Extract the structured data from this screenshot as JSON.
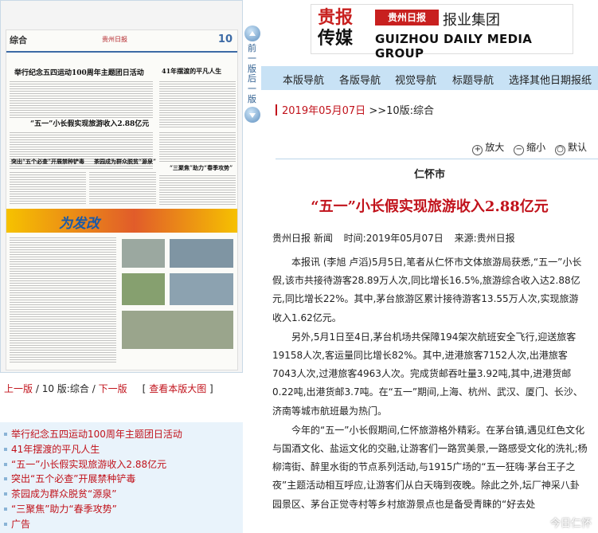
{
  "thumbnail": {
    "section": "综合",
    "masthead": "贵州日报",
    "page_number": "10",
    "headlines": [
      "举行纪念五四运动100周年主题团日活动",
      "41年摆渡的平凡人生",
      "“五一”小长假实现旅游收入2.88亿元",
      "突出“五个必查”开展禁种铲毒",
      "茶园成为群众脱贫“源泉”",
      "“三聚焦”助力“春季攻势”"
    ],
    "ad_text": "为发改"
  },
  "side_nav": {
    "prev": "前一版",
    "next": "后一版"
  },
  "page_nav": {
    "prev": "上一版",
    "current": "10 版:综合",
    "next": "下一版",
    "view_large": "查看本版大图"
  },
  "article_list": [
    "举行纪念五四运动100周年主题团日活动",
    "41年摆渡的平凡人生",
    "“五一”小长假实现旅游收入2.88亿元",
    "突出“五个必查”开展禁种铲毒",
    "茶园成为群众脱贫“源泉”",
    "“三聚焦”助力“春季攻势”",
    "广告"
  ],
  "logo": {
    "cn_top": "贵报",
    "cn_bottom": "传媒",
    "brand": "贵州日报",
    "group": "报业集团",
    "en": "GUIZHOU DAILY MEDIA GROUP"
  },
  "navbar": [
    "本版导航",
    "各版导航",
    "视觉导航",
    "标题导航",
    "选择其他日期报纸"
  ],
  "crumb": {
    "date": "2019年05月07日",
    "section": ">>10版:综合"
  },
  "tools": {
    "zoom_in": "放大",
    "zoom_out": "缩小",
    "default": "默认"
  },
  "article": {
    "kicker": "仁怀市",
    "title": "“五一”小长假实现旅游收入2.88亿元",
    "meta": {
      "source": "贵州日报 新闻",
      "time": "时间:2019年05月07日",
      "origin": "来源:贵州日报"
    },
    "paragraphs": [
      "本报讯 (李旭 卢滔)5月5日,笔者从仁怀市文体旅游局获悉,“五一”小长假,该市共接待游客28.89万人次,同比增长16.5%,旅游综合收入达2.88亿元,同比增长22%。其中,茅台旅游区累计接待游客13.55万人次,实现旅游收入1.62亿元。",
      "另外,5月1日至4日,茅台机场共保障194架次航班安全飞行,迎送旅客19158人次,客运量同比增长82%。其中,进港旅客7152人次,出港旅客7043人次,过港旅客4963人次。完成货邮吞吐量3.92吨,其中,进港货邮0.22吨,出港货邮3.7吨。在“五一”期间,上海、杭州、武汉、厦门、长沙、济南等城市航班最为热门。",
      "今年的“五一”小长假期间,仁怀旅游格外精彩。在茅台镇,遇见红色文化与国酒文化、盐运文化的交融,让游客们一路赏美景,一路感受文化的洗礼;杨柳湾街、醉里水街的节点系列活动,与1915广场的“五一狂嗨·茅台王子之夜”主题活动相互呼应,让游客们从白天嗨到夜晚。除此之外,坛厂神采八卦园景区、茅台正觉寺村等乡村旅游景点也是备受青睐的“好去处"
    ]
  },
  "watermark": "今日仁怀"
}
